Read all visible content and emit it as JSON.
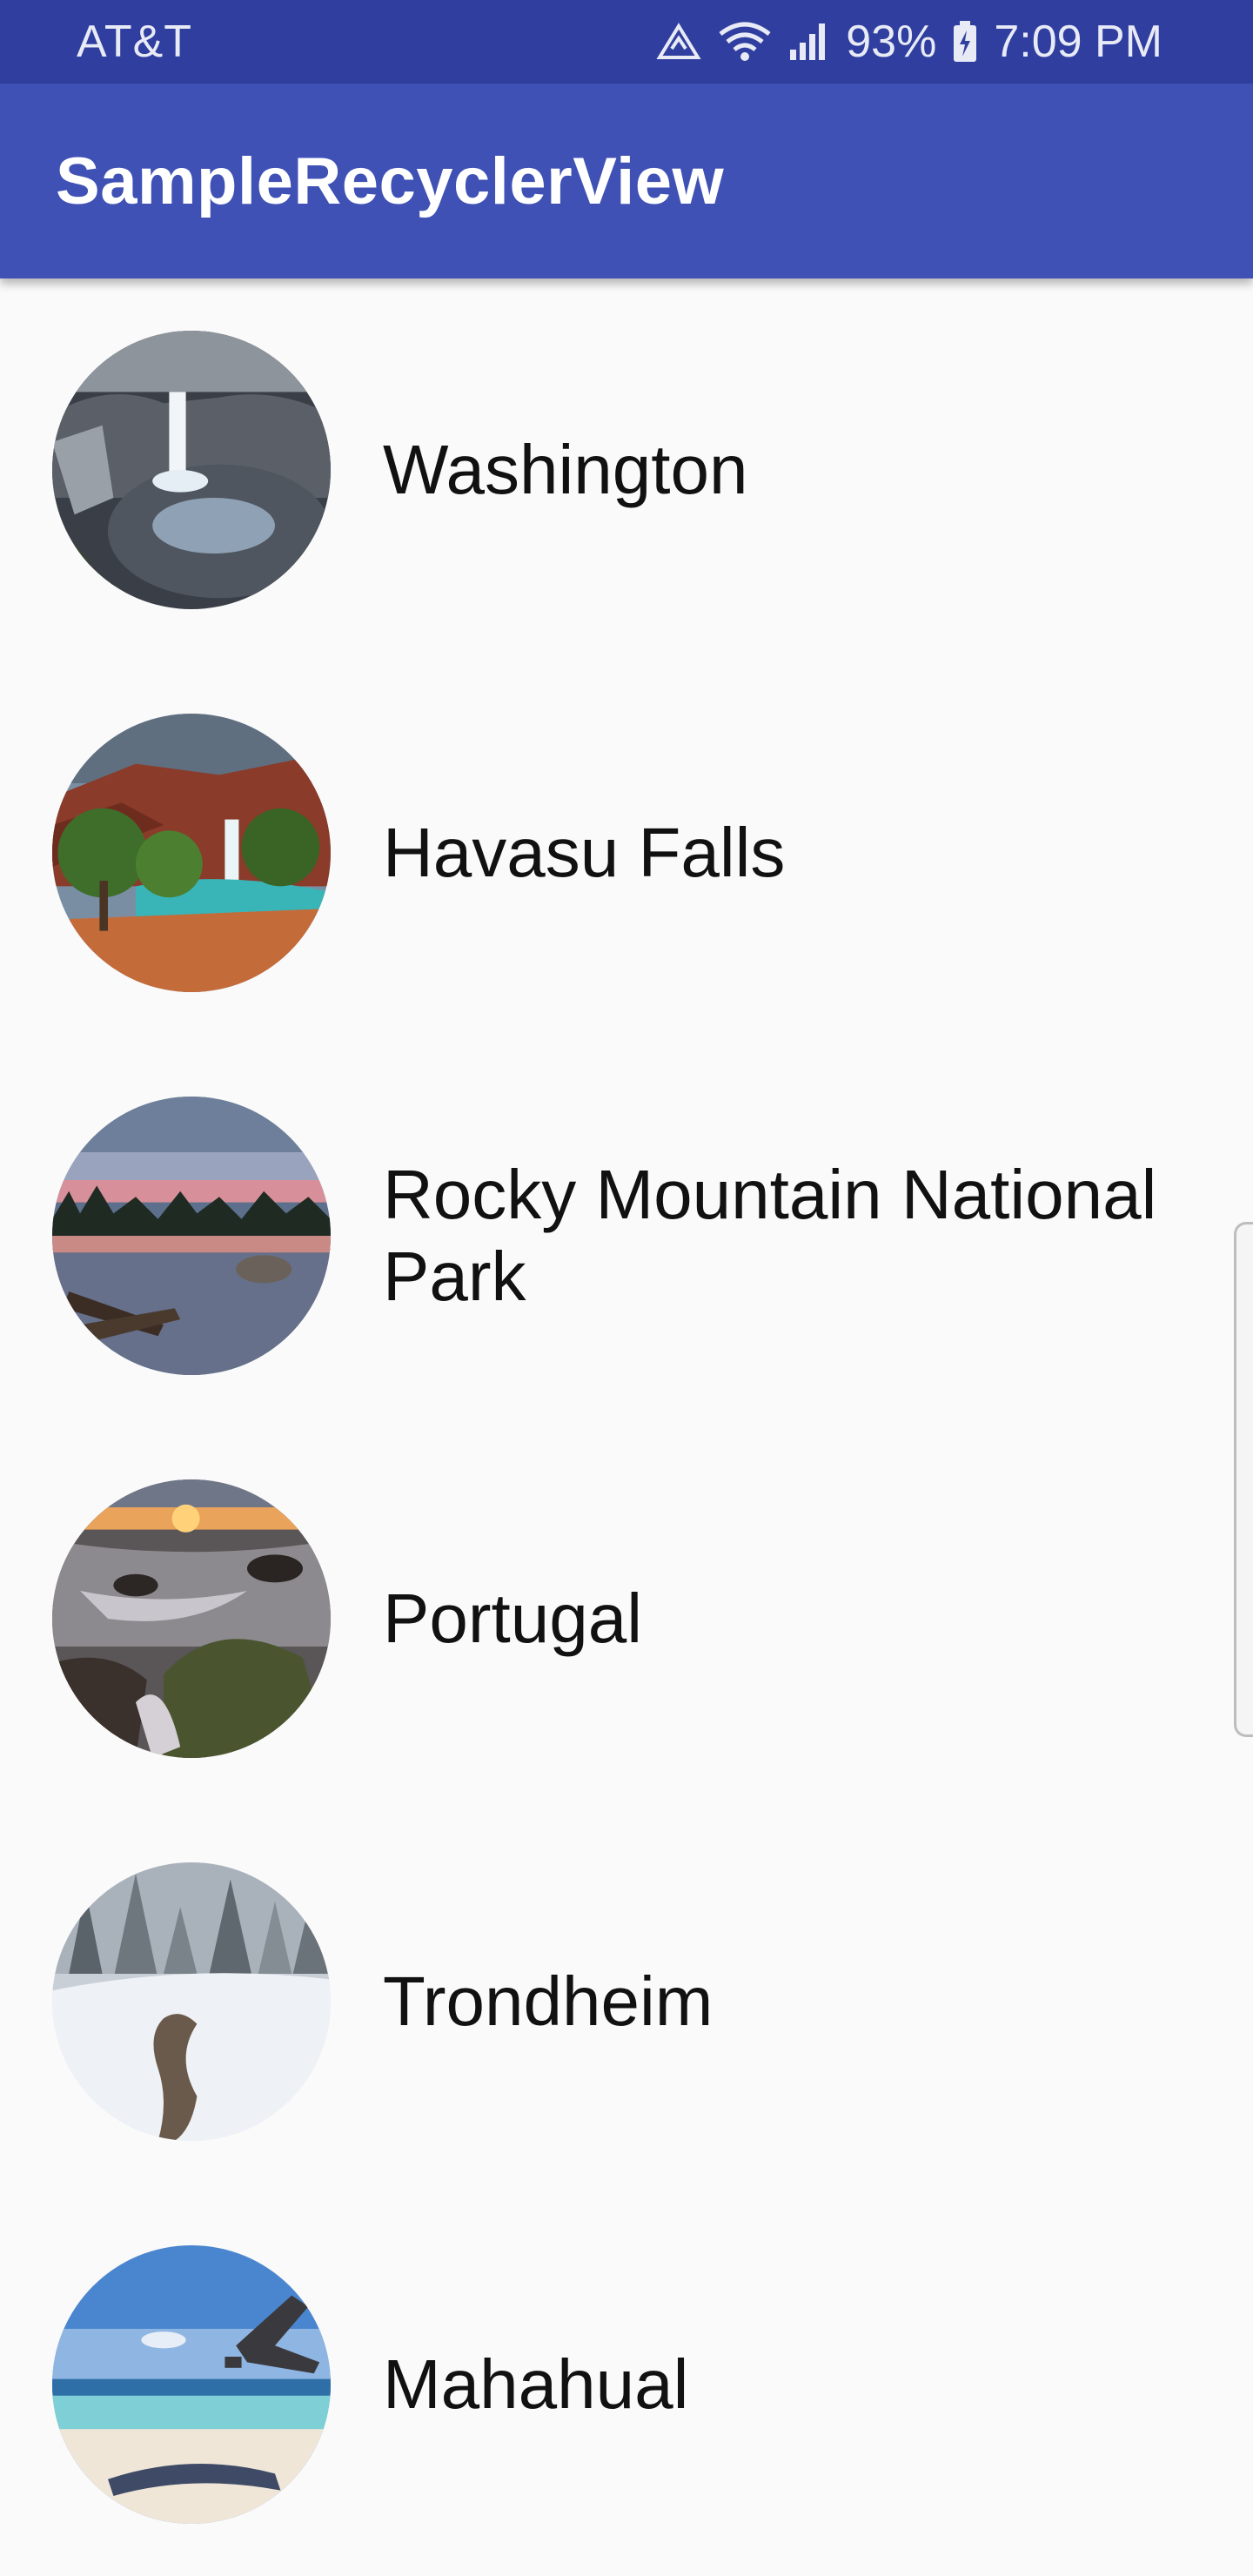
{
  "status_bar": {
    "carrier": "AT&T",
    "battery_percent": "93%",
    "time": "7:09 PM",
    "icons": [
      "data-saver-icon",
      "wifi-icon",
      "signal-icon",
      "battery-charging-icon"
    ]
  },
  "app_bar": {
    "title": "SampleRecyclerView"
  },
  "list": {
    "items": [
      {
        "label": "Washington",
        "thumbnail": "waterfall-canyon-image"
      },
      {
        "label": "Havasu Falls",
        "thumbnail": "havasu-falls-image"
      },
      {
        "label": "Rocky Mountain National Park",
        "thumbnail": "mountain-lake-sunset-image"
      },
      {
        "label": "Portugal",
        "thumbnail": "rocky-shore-sunset-image"
      },
      {
        "label": "Trondheim",
        "thumbnail": "snowy-forest-image"
      },
      {
        "label": "Mahahual",
        "thumbnail": "tropical-beach-image"
      }
    ]
  },
  "colors": {
    "status_bar": "#303F9F",
    "app_bar": "#3F51B5",
    "background": "#FAFAFA"
  }
}
